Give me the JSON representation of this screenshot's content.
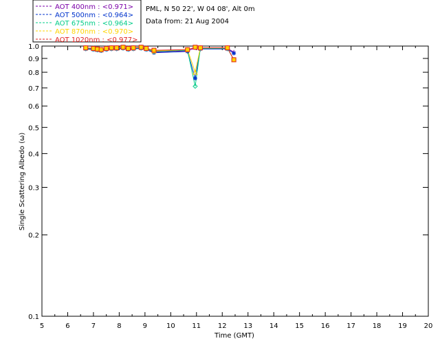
{
  "chart_data": {
    "type": "scatter",
    "xlabel": "Time (GMT)",
    "ylabel": "Single Scattering Albedo (ω)",
    "xlim": [
      5,
      20
    ],
    "ylim": [
      0.1,
      1.0
    ],
    "yscale": "log",
    "x_ticks": [
      "5",
      "6",
      "7",
      "8",
      "9",
      "10",
      "11",
      "12",
      "13",
      "14",
      "15",
      "16",
      "17",
      "18",
      "19",
      "20"
    ],
    "y_ticks": [
      "1.0",
      "0.9",
      "0.8",
      "0.7",
      "0.6",
      "0.5",
      "0.4",
      "0.3",
      "0.2",
      "0.1"
    ],
    "info": [
      "PML, N 50 22', W 04 08', Alt 0m",
      "Data from: 21 Aug 2004"
    ],
    "series": [
      {
        "name": "AOT  400nm : <0.971>",
        "color": "#7b00a8",
        "marker": "plus",
        "x": [
          6.7,
          7.0,
          7.15,
          7.3,
          7.5,
          7.7,
          7.9,
          8.15,
          8.35,
          8.55,
          8.85,
          9.05,
          9.35,
          10.65,
          10.95,
          11.15,
          12.2,
          12.45
        ],
        "y": [
          0.98,
          0.975,
          0.97,
          0.965,
          0.975,
          0.98,
          0.98,
          0.985,
          0.975,
          0.98,
          0.985,
          0.975,
          0.95,
          0.96,
          0.985,
          0.98,
          0.98,
          0.95
        ]
      },
      {
        "name": "AOT  500nm : <0.964>",
        "color": "#0033cc",
        "marker": "star",
        "x": [
          6.7,
          7.0,
          7.15,
          7.3,
          7.5,
          7.7,
          7.9,
          8.15,
          8.35,
          8.55,
          8.85,
          9.05,
          9.35,
          10.65,
          10.95,
          11.15,
          12.2,
          12.45
        ],
        "y": [
          0.975,
          0.97,
          0.965,
          0.96,
          0.97,
          0.975,
          0.975,
          0.98,
          0.97,
          0.975,
          0.98,
          0.97,
          0.945,
          0.955,
          0.76,
          0.975,
          0.975,
          0.94
        ]
      },
      {
        "name": "AOT  675nm : <0.964>",
        "color": "#00cc88",
        "marker": "diamond",
        "x": [
          6.7,
          7.0,
          7.15,
          7.3,
          7.5,
          7.7,
          7.9,
          8.15,
          8.35,
          8.55,
          8.85,
          9.05,
          9.35,
          10.65,
          10.95,
          11.15,
          12.2,
          12.45
        ],
        "y": [
          0.98,
          0.975,
          0.97,
          0.965,
          0.975,
          0.98,
          0.98,
          0.985,
          0.975,
          0.98,
          0.985,
          0.975,
          0.955,
          0.965,
          0.71,
          0.98,
          0.98,
          0.89
        ]
      },
      {
        "name": "AOT  870nm : <0.970>",
        "color": "#ffd400",
        "marker": "triangle",
        "x": [
          6.7,
          7.0,
          7.15,
          7.3,
          7.5,
          7.7,
          7.9,
          8.15,
          8.35,
          8.55,
          8.85,
          9.05,
          9.35,
          10.65,
          10.95,
          11.15,
          12.2,
          12.45
        ],
        "y": [
          0.985,
          0.98,
          0.975,
          0.97,
          0.98,
          0.985,
          0.985,
          0.99,
          0.98,
          0.985,
          0.99,
          0.98,
          0.96,
          0.97,
          0.8,
          0.985,
          0.985,
          0.89
        ]
      },
      {
        "name": "AOT 1020nm : <0.977>",
        "color": "#e02020",
        "marker": "square",
        "x": [
          6.7,
          7.0,
          7.15,
          7.3,
          7.5,
          7.7,
          7.9,
          8.15,
          8.35,
          8.55,
          8.85,
          9.05,
          9.35,
          10.65,
          10.95,
          11.15,
          12.2,
          12.45
        ],
        "y": [
          0.985,
          0.98,
          0.975,
          0.97,
          0.98,
          0.985,
          0.985,
          0.99,
          0.98,
          0.985,
          0.99,
          0.98,
          0.965,
          0.97,
          0.99,
          0.985,
          0.985,
          0.89
        ]
      }
    ]
  },
  "colors": {
    "square_fill": "#ffd400",
    "axis": "#000000"
  }
}
